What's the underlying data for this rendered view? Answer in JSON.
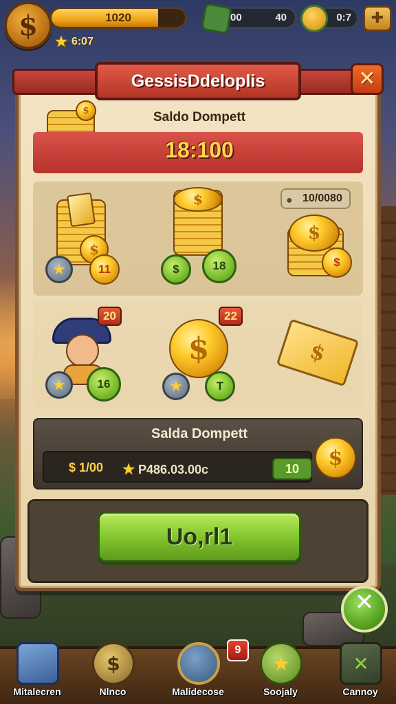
{
  "hud": {
    "coin_symbol": "$",
    "bar_value": "1020",
    "bar_fill": 0.8,
    "sub_value": "6:07",
    "res1_value": "00",
    "res1_right": "40",
    "res2_value": "0:7",
    "menu_symbol": "✚"
  },
  "dialog": {
    "title": "GessisDdeloplis",
    "close_symbol": "✕",
    "balance_label": "Saldo Dompett",
    "balance_value": "18:100",
    "price_tag": "10/0080",
    "row1": {
      "badge_a": "11",
      "badge_b": "18",
      "badge_c": "$"
    },
    "row2": {
      "tag_a": "20",
      "tag_b": "22",
      "badge_a": "16",
      "badge_b": "T"
    },
    "summary_label": "Salda Dompett",
    "summary_left": "$ 1/00",
    "summary_mid": "P486.03.00c",
    "summary_right": "10",
    "confirm_label": "Uo,rl1"
  },
  "fab_symbol": "✕",
  "nav": {
    "items": [
      {
        "label": "Mitalecren",
        "icon": "chest-icon"
      },
      {
        "label": "Nlnco",
        "icon": "coin-icon"
      },
      {
        "label": "Malidecose",
        "icon": "shop-icon"
      },
      {
        "label": "Soojaly",
        "icon": "star-icon"
      },
      {
        "label": "Cannoy",
        "icon": "settings-icon"
      }
    ],
    "badge": "9"
  },
  "colors": {
    "accent_red": "#b8332c",
    "accent_green": "#7fc22c",
    "gold": "#ffcc2e",
    "panel": "#f3e4c4"
  }
}
